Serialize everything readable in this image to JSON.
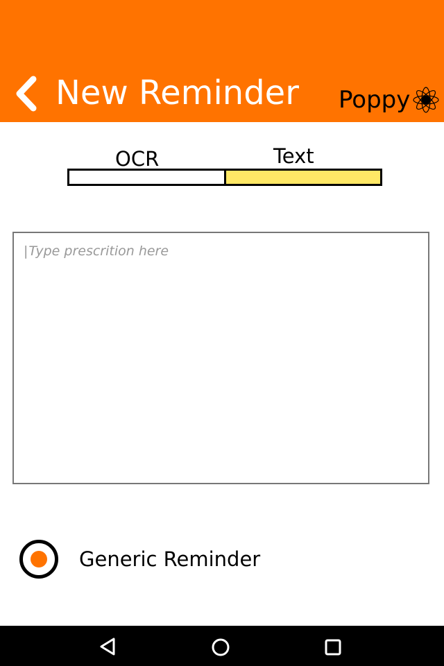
{
  "header": {
    "title": "New Reminder",
    "brand_name": "Poppy",
    "background": "#ff7300",
    "icons": {
      "back": "chevron-left-icon",
      "logo": "flower-logo-icon"
    }
  },
  "mode_toggle": {
    "options": [
      {
        "label": "OCR",
        "selected": false
      },
      {
        "label": "Text",
        "selected": true
      }
    ],
    "selected_color": "#ffe866"
  },
  "prescription_input": {
    "value": "",
    "placeholder": "Type prescrition here"
  },
  "generic_reminder": {
    "label": "Generic Reminder",
    "selected": true,
    "accent": "#ff7300"
  },
  "system_nav": {
    "icons": [
      "nav-back-icon",
      "nav-home-icon",
      "nav-recents-icon"
    ]
  }
}
